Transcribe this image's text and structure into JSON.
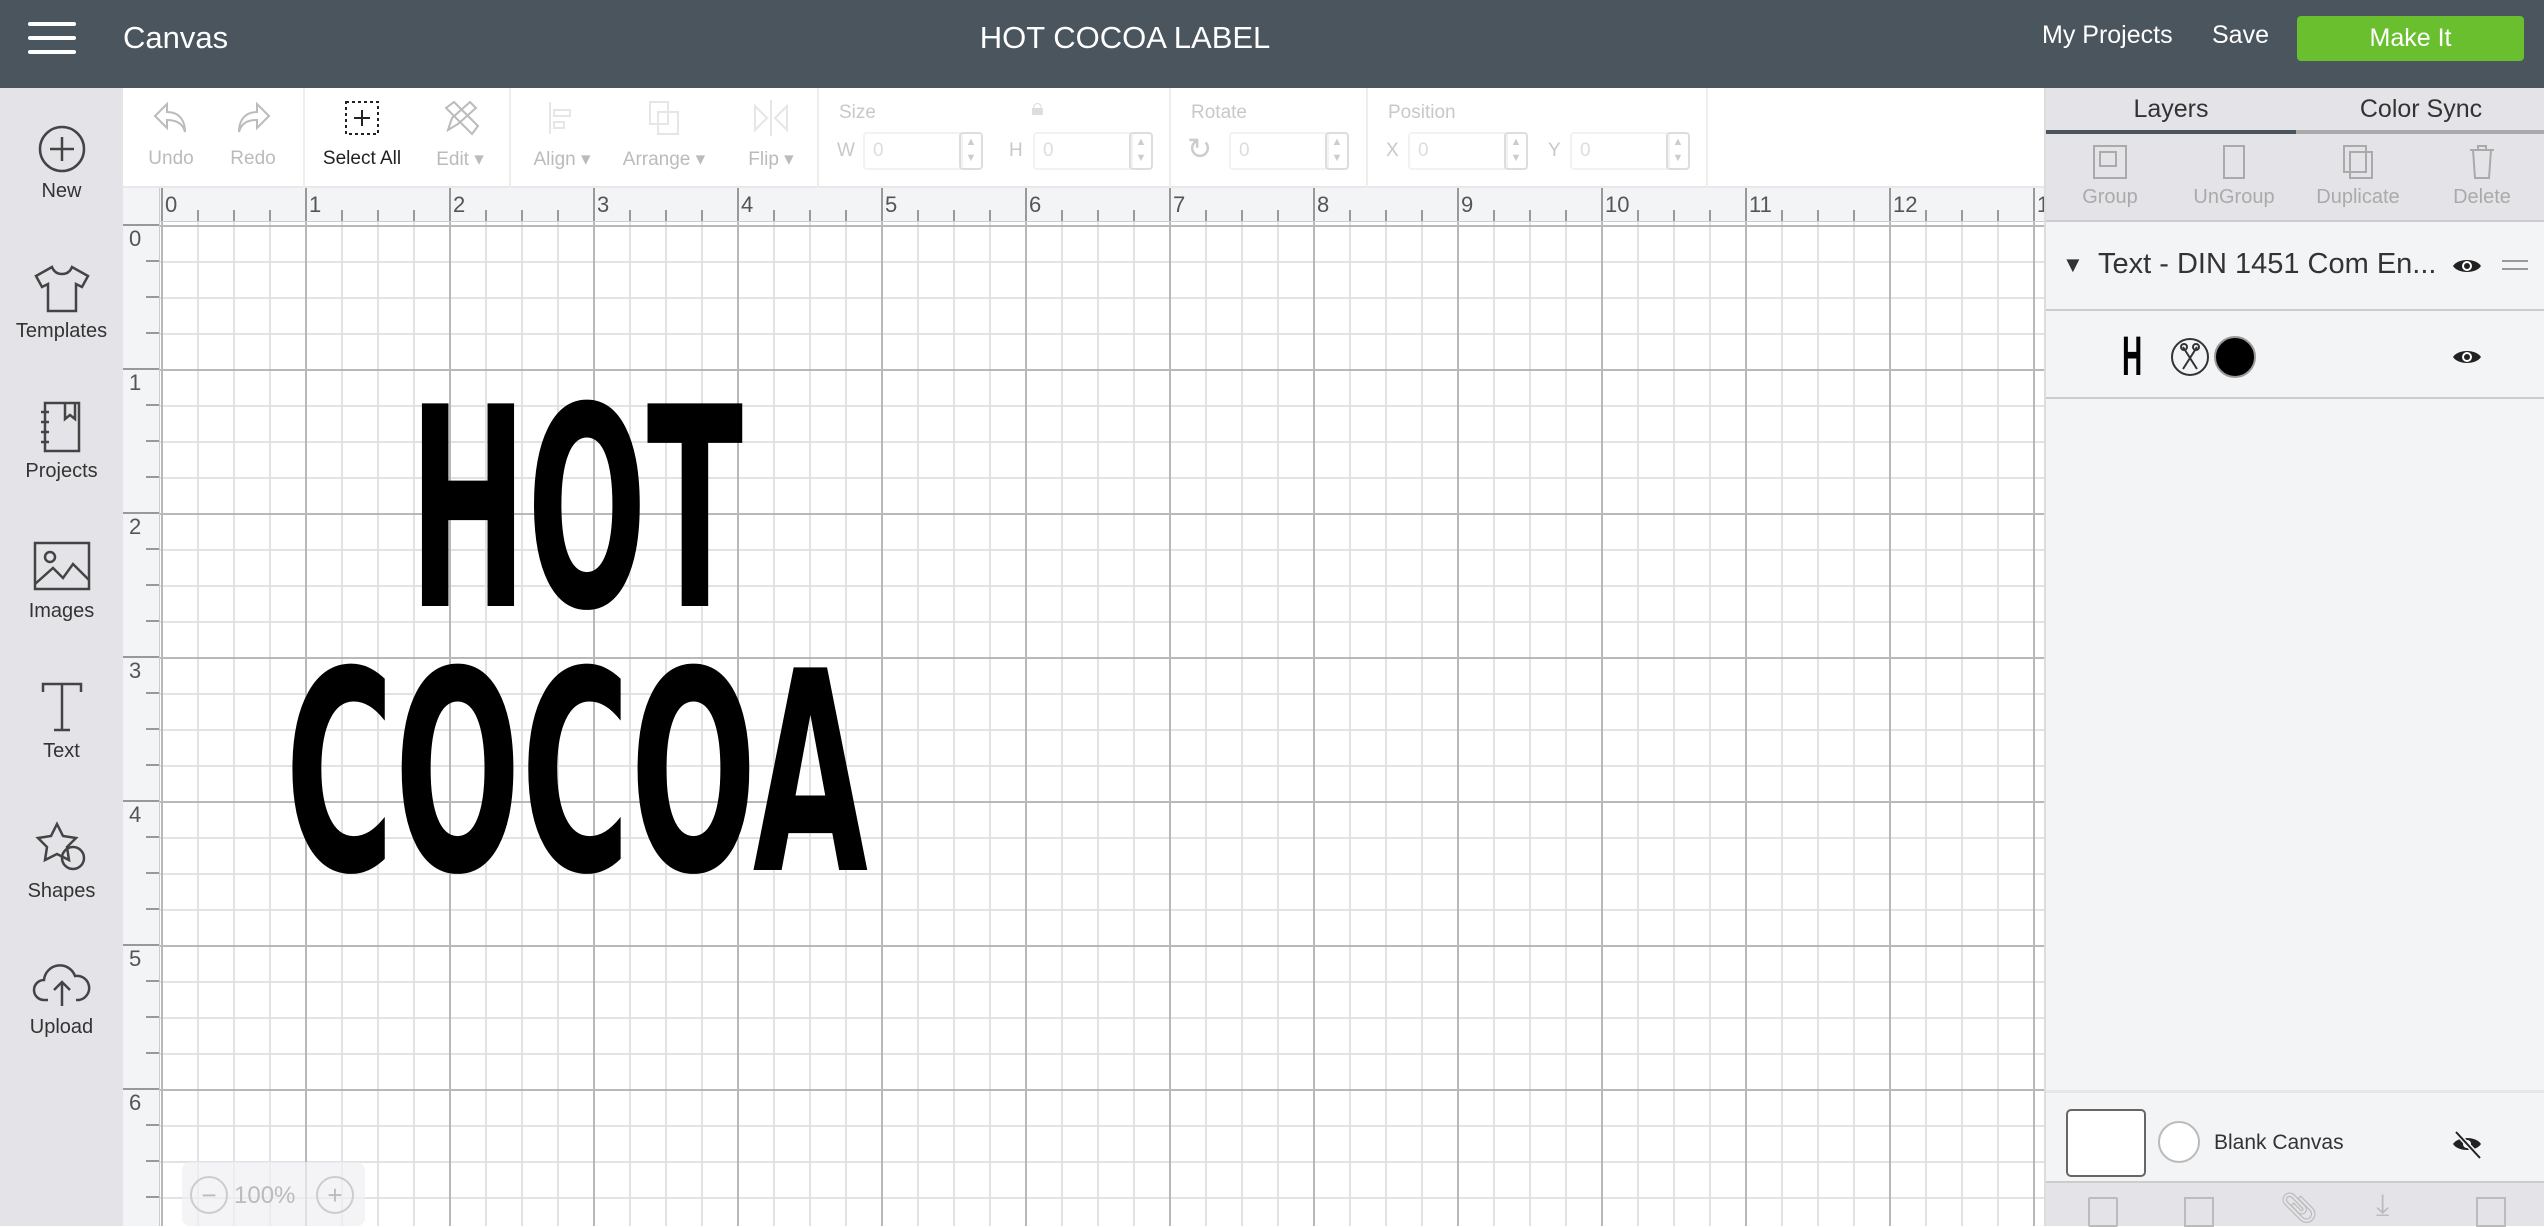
{
  "header": {
    "app_name": "Canvas",
    "document_title": "HOT COCOA LABEL",
    "my_projects": "My Projects",
    "save": "Save",
    "make_it": "Make It",
    "make_it_color": "#6abf2e",
    "bar_color": "#4a555e"
  },
  "sidebar": {
    "items": [
      {
        "label": "New",
        "icon": "plus-circle-icon"
      },
      {
        "label": "Templates",
        "icon": "tshirt-icon"
      },
      {
        "label": "Projects",
        "icon": "notebook-icon"
      },
      {
        "label": "Images",
        "icon": "image-icon"
      },
      {
        "label": "Text",
        "icon": "text-icon"
      },
      {
        "label": "Shapes",
        "icon": "shapes-icon"
      },
      {
        "label": "Upload",
        "icon": "cloud-upload-icon"
      }
    ]
  },
  "toolbar": {
    "undo": "Undo",
    "redo": "Redo",
    "select_all": "Select All",
    "edit": "Edit",
    "align": "Align",
    "arrange": "Arrange",
    "flip": "Flip",
    "size": {
      "label": "Size",
      "w_label": "W",
      "w_value": "0",
      "h_label": "H",
      "h_value": "0"
    },
    "rotate": {
      "label": "Rotate",
      "value": "0"
    },
    "position": {
      "label": "Position",
      "x_label": "X",
      "x_value": "0",
      "y_label": "Y",
      "y_value": "0"
    }
  },
  "rulers": {
    "horizontal": [
      "0",
      "1",
      "2",
      "3",
      "4",
      "5",
      "6",
      "7",
      "8",
      "9",
      "10",
      "11",
      "12",
      "1"
    ],
    "vertical": [
      "0",
      "1",
      "2",
      "3",
      "4",
      "5",
      "6"
    ]
  },
  "canvas": {
    "line1": "HOT",
    "line2": "COCOA",
    "zoom": "100%"
  },
  "panel": {
    "tabs": [
      "Layers",
      "Color Sync"
    ],
    "actions": [
      "Group",
      "UnGroup",
      "Duplicate",
      "Delete"
    ],
    "layer_group": "Text - DIN 1451 Com En...",
    "layer_glyph": "H",
    "layer_color": "#000000",
    "blank_canvas": "Blank Canvas"
  }
}
